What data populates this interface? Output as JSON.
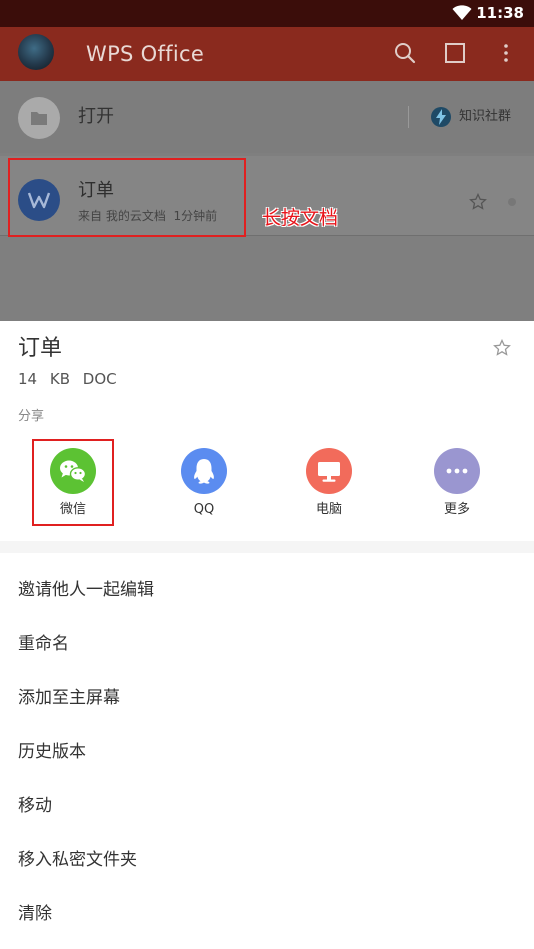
{
  "status_bar": {
    "time": "11:38"
  },
  "app_bar": {
    "title": "WPS Office"
  },
  "open_row": {
    "label": "打开",
    "community_label": "知识社群"
  },
  "document_row": {
    "name": "订单",
    "source": "来自 我的云文档",
    "modified": "1分钟前"
  },
  "annotation": {
    "longpress_text": "长按文档",
    "color": "#e8141a"
  },
  "sheet": {
    "title": "订单",
    "size": "14 KB",
    "type": "DOC",
    "share_heading": "分享",
    "share_targets": [
      {
        "label": "微信",
        "icon": "wechat-icon",
        "color": "#5cc233"
      },
      {
        "label": "QQ",
        "icon": "qq-icon",
        "color": "#5b8cf0"
      },
      {
        "label": "电脑",
        "icon": "computer-icon",
        "color": "#f26b5b"
      },
      {
        "label": "更多",
        "icon": "more-icon",
        "color": "#9a96d0"
      }
    ],
    "menu": [
      {
        "label": "邀请他人一起编辑"
      },
      {
        "label": "重命名"
      },
      {
        "label": "添加至主屏幕"
      },
      {
        "label": "历史版本"
      },
      {
        "label": "移动"
      },
      {
        "label": "移入私密文件夹"
      },
      {
        "label": "清除"
      }
    ]
  },
  "colors": {
    "app_bar": "#8a2a1e",
    "status_bar": "#3b0d0a",
    "highlight": "#e02020"
  }
}
